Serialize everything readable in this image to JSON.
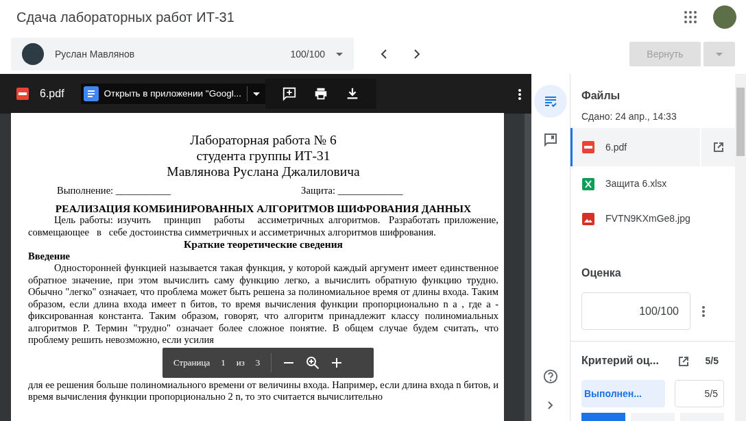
{
  "header": {
    "title": "Сдача лабораторных работ ИТ-31"
  },
  "student_bar": {
    "name": "Руслан Мавлянов",
    "grade": "100/100"
  },
  "return_button": {
    "label": "Вернуть",
    "disabled": true
  },
  "viewer": {
    "file_name": "6.pdf",
    "open_with": "Открыть в приложении \"Googl...",
    "document": [
      {
        "kind": "title",
        "text": "Лабораторная работа № 6"
      },
      {
        "kind": "title",
        "text": "студента группы ИТ-31"
      },
      {
        "kind": "title",
        "text": "Мавлянова Руслана Джалиловича"
      },
      {
        "kind": "fields",
        "left": "Выполнение: ___________",
        "right": "Защита: _____________"
      },
      {
        "kind": "heading",
        "text": "РЕАЛИЗАЦИЯ КОМБИНИРОВАННЫХ АЛГОРИТМОВ ШИФРОВАНИЯ ДАННЫХ"
      },
      {
        "kind": "paragraph",
        "text": "Цель работы: изучить   принцип   работы   ассиметричных алгоритмов.  Разработать приложение, совмещающее   в   себе достоинства симметричных и ассиметричных алгоритмов шифрования."
      },
      {
        "kind": "subheading",
        "text": "Краткие теоретические сведения"
      },
      {
        "kind": "section",
        "text": "Введение"
      },
      {
        "kind": "paragraph",
        "text": "Односторонней функцией называется такая функция, у которой каждый аргумент имеет единственное обратное значение, при этом вычислить саму функцию легко, а вычислить обратную функцию трудно. Обычно \"легко\" означает, что проблема может быть решена за полиномиальное время от длины входа. Таким образом, если длина входа имеет n битов, то время вычисления функции пропорционально n a , где a - фиксированная константа. Таким образом, говорят, что алгоритм принадлежит классу полиномиальных алгоритмов P. Термин \"трудно\" означает более сложное понятие. В общем случае будем считать, что проблему решить невозможно, если усилия"
      },
      {
        "kind": "continuation",
        "text": "для ее решения больше полиномиального времени от величины входа. Например, если длина входа n битов, и время вычисления функции пропорционально 2 n, то это считается вычислительно"
      }
    ],
    "page_label": "Страница",
    "page": "1",
    "of_label": "из",
    "page_count": "3"
  },
  "files_panel": {
    "title": "Файлы",
    "submitted": "Сдано: 24 апр., 14:33",
    "files": [
      {
        "kind": "pdf",
        "name": "6.pdf",
        "selected": true
      },
      {
        "kind": "sheet",
        "name": "Защита 6.xlsx",
        "selected": false
      },
      {
        "kind": "image",
        "name": "FVTN9KXmGe8.jpg",
        "selected": false
      }
    ]
  },
  "grade": {
    "title": "Оценка",
    "value": "100/100"
  },
  "rubric": {
    "title": "Критерий оц...",
    "score": "5/5",
    "level": "Выполнен...",
    "points": "5/5"
  }
}
